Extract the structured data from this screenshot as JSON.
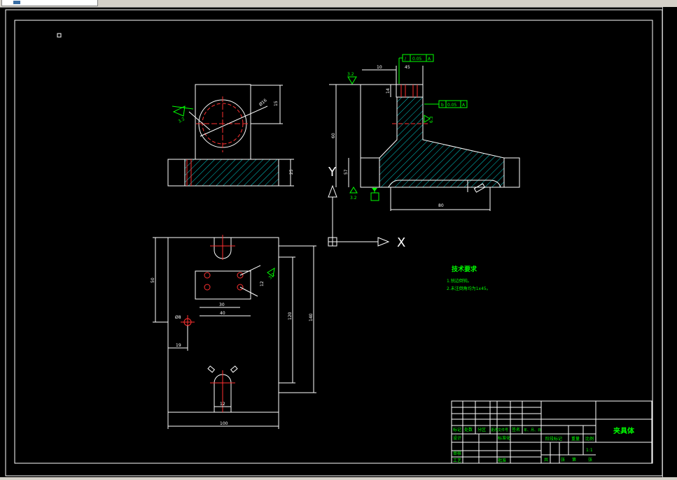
{
  "drawing": {
    "tech_req_title": "技术要求",
    "tech_req_lines": [
      "1.锐边倒钝。",
      "2.未注倒角均为1x45。"
    ],
    "title_block_name": "夹具体",
    "scale": "1:1",
    "axis_x_label": "X",
    "axis_y_label": "Y",
    "tb_labels": {
      "mark": "标记",
      "count": "处数",
      "zone": "分区",
      "doc": "更改文件号",
      "sign": "签名",
      "date": "年、月、日",
      "design": "设计",
      "std": "标准化",
      "review": "审核",
      "process": "工艺",
      "approve": "批准",
      "stage": "阶段标记",
      "weight": "重量",
      "scale_label": "比例",
      "sheet": "共",
      "sheet2": "张",
      "page": "第",
      "page2": "张"
    },
    "dimensions": {
      "front_height": "15",
      "front_base": "25",
      "phi": "Ø16",
      "side_top": "10",
      "side_h1": "60",
      "side_h2": "57",
      "side_b": "14",
      "side_w": "80",
      "side_small": "45",
      "plan_w": "100",
      "plan_h1": "140",
      "plan_h2": "120",
      "plan_left": "50",
      "plan_hole": "Ø8",
      "plan_x": "19",
      "plan_d1": "30",
      "plan_d2": "40",
      "plan_d3": "12",
      "plan_slot": "12",
      "ra1": "3.2",
      "ra2": "3.2",
      "ra3": "6.3",
      "ra4": "3.2",
      "gt1": "0.05",
      "gt2": "0.05",
      "gt_sym1": "A",
      "gt_sym2": "A"
    }
  }
}
